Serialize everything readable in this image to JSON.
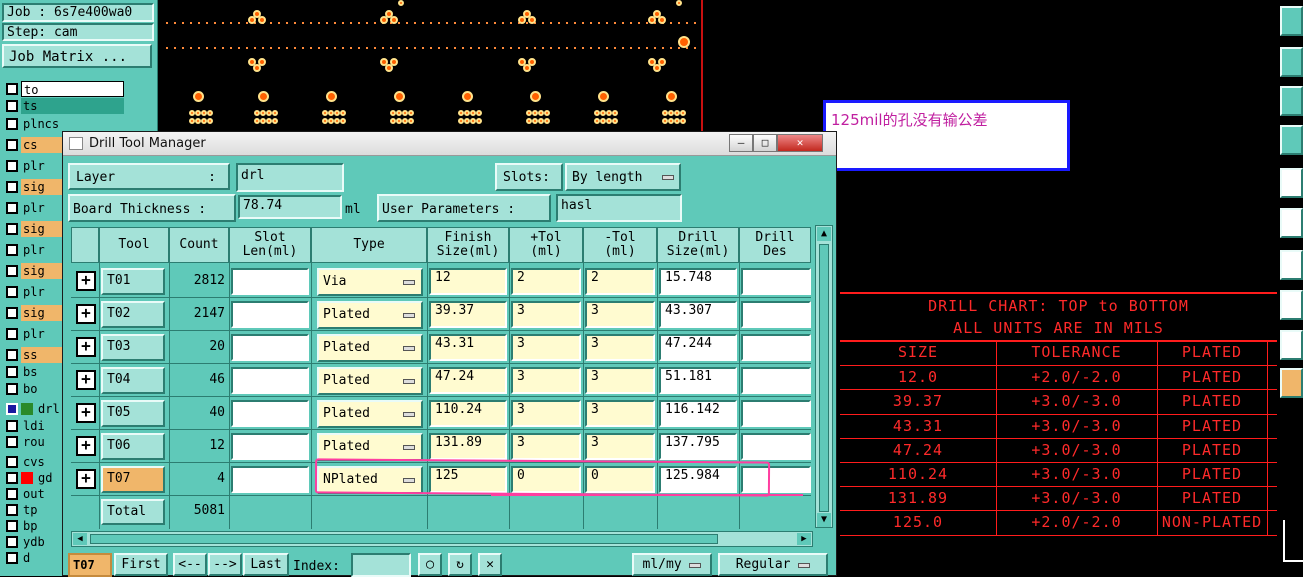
{
  "job": {
    "label": "Job : 6s7e400wa0",
    "step": "Step: cam",
    "matrix_button": "Job Matrix ..."
  },
  "layers": [
    {
      "name": "to",
      "color": "#5fc9b9",
      "selected": true
    },
    {
      "name": "ts",
      "color": "#5fc9b9",
      "selected": true
    },
    {
      "name": "plncs",
      "color": "#5fc9b9"
    },
    {
      "name": "cs",
      "color": "#f0b66a"
    },
    {
      "name": "plr",
      "color": "#5fc9b9"
    },
    {
      "name": "sig",
      "color": "#f0b66a"
    },
    {
      "name": "plr",
      "color": "#5fc9b9"
    },
    {
      "name": "sig",
      "color": "#f0b66a"
    },
    {
      "name": "plr",
      "color": "#5fc9b9"
    },
    {
      "name": "sig",
      "color": "#f0b66a"
    },
    {
      "name": "plr",
      "color": "#5fc9b9"
    },
    {
      "name": "sig",
      "color": "#f0b66a"
    },
    {
      "name": "plr",
      "color": "#5fc9b9"
    },
    {
      "name": "ss",
      "color": "#f0b66a"
    },
    {
      "name": "bs",
      "color": "#5fc9b9"
    },
    {
      "name": "bo",
      "color": "#5fc9b9"
    },
    {
      "name": "drl",
      "color": "#5fc9b9",
      "swatch": "#2a8a2a",
      "active": true
    },
    {
      "name": "ldi",
      "color": "#5fc9b9"
    },
    {
      "name": "rou",
      "color": "#5fc9b9"
    },
    {
      "name": "cvs",
      "color": "#5fc9b9"
    },
    {
      "name": "gd",
      "color": "#5fc9b9",
      "swatch": "#ff0000"
    },
    {
      "name": "out",
      "color": "#5fc9b9"
    },
    {
      "name": "tp",
      "color": "#5fc9b9"
    },
    {
      "name": "bp",
      "color": "#5fc9b9"
    },
    {
      "name": "ydb",
      "color": "#5fc9b9"
    },
    {
      "name": "d",
      "color": "#5fc9b9"
    }
  ],
  "note": {
    "text": "125mil的孔没有输公差"
  },
  "window": {
    "title": "Drill Tool Manager",
    "layer_label": "Layer",
    "layer_colon": ":",
    "layer_value": "drl",
    "slots_label": "Slots:",
    "slots_value": "By length",
    "thickness_label": "Board Thickness :",
    "thickness_value": "78.74",
    "thickness_unit": "ml",
    "user_params_label": "User Parameters :",
    "user_params_value": "hasl",
    "columns": [
      "Tool",
      "Count",
      "Slot Len(ml)",
      "Type",
      "Finish Size(ml)",
      "+Tol (ml)",
      "-Tol (ml)",
      "Drill Size(ml)",
      "Drill Des"
    ],
    "rows": [
      {
        "tool": "T01",
        "count": "2812",
        "type": "Via",
        "finish": "12",
        "ptol": "2",
        "mtol": "2",
        "drill": "15.748"
      },
      {
        "tool": "T02",
        "count": "2147",
        "type": "Plated",
        "finish": "39.37",
        "ptol": "3",
        "mtol": "3",
        "drill": "43.307"
      },
      {
        "tool": "T03",
        "count": "20",
        "type": "Plated",
        "finish": "43.31",
        "ptol": "3",
        "mtol": "3",
        "drill": "47.244"
      },
      {
        "tool": "T04",
        "count": "46",
        "type": "Plated",
        "finish": "47.24",
        "ptol": "3",
        "mtol": "3",
        "drill": "51.181"
      },
      {
        "tool": "T05",
        "count": "40",
        "type": "Plated",
        "finish": "110.24",
        "ptol": "3",
        "mtol": "3",
        "drill": "116.142"
      },
      {
        "tool": "T06",
        "count": "12",
        "type": "Plated",
        "finish": "131.89",
        "ptol": "3",
        "mtol": "3",
        "drill": "137.795"
      },
      {
        "tool": "T07",
        "count": "4",
        "type": "NPlated",
        "finish": "125",
        "ptol": "0",
        "mtol": "0",
        "drill": "125.984",
        "highlight": true
      }
    ],
    "total_label": "Total",
    "total_value": "5081",
    "bottom": {
      "current": "T07",
      "first": "First",
      "prev": "<--",
      "next": "-->",
      "last": "Last",
      "index_label": "Index:",
      "index_value": "",
      "units": "ml/my",
      "mode": "Regular"
    }
  },
  "drill_chart": {
    "title1": "DRILL CHART: TOP to BOTTOM",
    "title2": "ALL UNITS ARE IN MILS",
    "headers": [
      "SIZE",
      "TOLERANCE",
      "PLATED"
    ],
    "rows": [
      [
        "12.0",
        "+2.0/-2.0",
        "PLATED"
      ],
      [
        "39.37",
        "+3.0/-3.0",
        "PLATED"
      ],
      [
        "43.31",
        "+3.0/-3.0",
        "PLATED"
      ],
      [
        "47.24",
        "+3.0/-3.0",
        "PLATED"
      ],
      [
        "110.24",
        "+3.0/-3.0",
        "PLATED"
      ],
      [
        "131.89",
        "+3.0/-3.0",
        "PLATED"
      ],
      [
        "125.0",
        "+2.0/-2.0",
        "NON-PLATED"
      ]
    ]
  },
  "colors": {
    "panel": "#5fc9b9",
    "chart": "#ff2a2a",
    "highlight": "#ff3ea0",
    "note_border": "#1a1aff"
  }
}
